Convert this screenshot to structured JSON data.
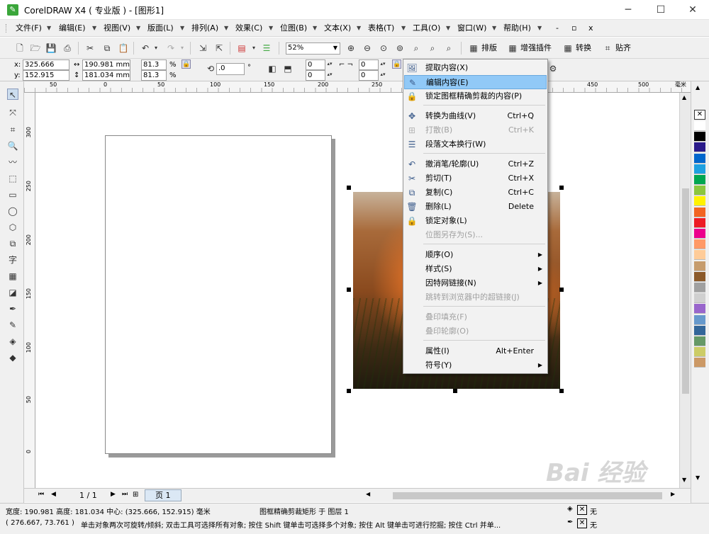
{
  "window": {
    "title": "CorelDRAW X4 ( 专业版 ) - [图形1]",
    "controls": [
      "minimize",
      "maximize",
      "close"
    ]
  },
  "menubar": {
    "items": [
      "文件(F)",
      "编辑(E)",
      "视图(V)",
      "版面(L)",
      "排列(A)",
      "效果(C)",
      "位图(B)",
      "文本(X)",
      "表格(T)",
      "工具(O)",
      "窗口(W)",
      "帮助(H)"
    ],
    "mdi_controls": [
      "-",
      "▫",
      "x"
    ]
  },
  "toolbar1": {
    "zoom": "52%",
    "plugins": [
      "排版",
      "增强插件",
      "转换",
      "贴齐"
    ]
  },
  "propertybar": {
    "x_label": "x:",
    "x_value": "325.666 mm",
    "y_label": "y:",
    "y_value": "152.915 mm",
    "width_value": "190.981 mm",
    "height_value": "181.034 mm",
    "scale_x": "81.3",
    "scale_y": "81.3",
    "pct": "%",
    "rotation": ".0",
    "degree": "°",
    "field_a": "0",
    "field_b": "0",
    "field_c": "0",
    "field_d": "0"
  },
  "ruler_h": {
    "unit": "毫米",
    "ticks": [
      "50",
      "0",
      "50",
      "100",
      "150",
      "200",
      "250",
      "300",
      "350",
      "400",
      "450",
      "500"
    ]
  },
  "ruler_v": {
    "ticks": [
      "300",
      "250",
      "200",
      "150",
      "100",
      "50",
      "0"
    ]
  },
  "context_menu": {
    "items": [
      {
        "icon": "extract-icon",
        "label": "提取内容(X)",
        "shortcut": "",
        "state": "normal"
      },
      {
        "icon": "edit-content-icon",
        "label": "编辑内容(E)",
        "shortcut": "",
        "state": "highlighted"
      },
      {
        "icon": "lock-frame-icon",
        "label": "锁定图框精确剪裁的内容(P)",
        "shortcut": "",
        "state": "normal"
      },
      {
        "icon": "curve-icon",
        "label": "转换为曲线(V)",
        "shortcut": "Ctrl+Q",
        "state": "normal"
      },
      {
        "icon": "break-apart-icon",
        "label": "打散(B)",
        "shortcut": "Ctrl+K",
        "state": "disabled"
      },
      {
        "icon": "paragraph-wrap-icon",
        "label": "段落文本换行(W)",
        "shortcut": "",
        "state": "normal"
      },
      {
        "icon": "undo-icon",
        "label": "撤消笔/轮廓(U)",
        "shortcut": "Ctrl+Z",
        "state": "normal"
      },
      {
        "icon": "cut-icon",
        "label": "剪切(T)",
        "shortcut": "Ctrl+X",
        "state": "normal"
      },
      {
        "icon": "copy-icon",
        "label": "复制(C)",
        "shortcut": "Ctrl+C",
        "state": "normal"
      },
      {
        "icon": "delete-icon",
        "label": "删除(L)",
        "shortcut": "Delete",
        "state": "normal"
      },
      {
        "icon": "lock-icon",
        "label": "锁定对象(L)",
        "shortcut": "",
        "state": "normal"
      },
      {
        "icon": "",
        "label": "位图另存为(S)...",
        "shortcut": "",
        "state": "disabled"
      },
      {
        "icon": "",
        "label": "顺序(O)",
        "shortcut": "",
        "state": "submenu"
      },
      {
        "icon": "",
        "label": "样式(S)",
        "shortcut": "",
        "state": "submenu"
      },
      {
        "icon": "",
        "label": "因特网链接(N)",
        "shortcut": "",
        "state": "submenu"
      },
      {
        "icon": "",
        "label": "跳转到浏览器中的超链接(J)",
        "shortcut": "",
        "state": "disabled"
      },
      {
        "icon": "",
        "label": "叠印填充(F)",
        "shortcut": "",
        "state": "disabled"
      },
      {
        "icon": "",
        "label": "叠印轮廓(O)",
        "shortcut": "",
        "state": "disabled"
      },
      {
        "icon": "",
        "label": "属性(I)",
        "shortcut": "Alt+Enter",
        "state": "normal"
      },
      {
        "icon": "",
        "label": "符号(Y)",
        "shortcut": "",
        "state": "submenu"
      }
    ]
  },
  "pagebar": {
    "page_count": "1 / 1",
    "page_tab": "页 1"
  },
  "statusbar": {
    "line1_info": "宽度: 190.981  高度: 181.034  中心: (325.666, 152.915)  毫米",
    "line1_object": "图框精确剪裁矩形 于 图层 1",
    "line1_fill": "无",
    "line2_coords": "( 276.667, 73.761 )",
    "line2_hint": "单击对象两次可旋转/倾斜; 双击工具可选择所有对象; 按住 Shift 键单击可选择多个对象; 按住 Alt 键单击可进行挖掘; 按住 Ctrl 并单...",
    "line2_outline": "无"
  },
  "palette": {
    "colors": [
      "#ffffff",
      "#000000",
      "#2a1a8a",
      "#0066cc",
      "#1ea0e0",
      "#00a650",
      "#8cc63e",
      "#fff200",
      "#f26522",
      "#ed1c24",
      "#ec008c",
      "#ff9966",
      "#ffcc99",
      "#c69c6d",
      "#8b5a2b",
      "#a0a0a0",
      "#d0d0d0",
      "#9966cc",
      "#6699cc",
      "#336699",
      "#669966",
      "#cccc66",
      "#cc9966"
    ]
  },
  "watermark": {
    "text": "Bai 经验"
  }
}
